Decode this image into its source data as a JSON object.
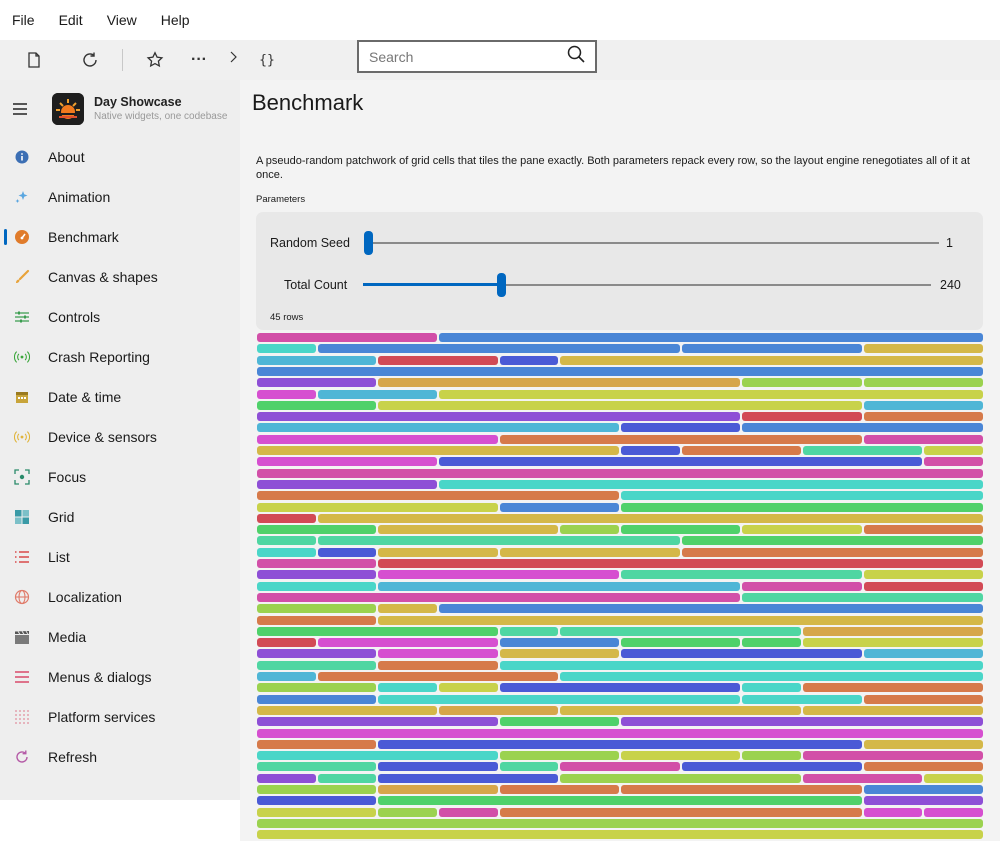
{
  "menu": [
    "File",
    "Edit",
    "View",
    "Help"
  ],
  "toolbar": {
    "icons": [
      "file-icon",
      "refresh-icon",
      "star-icon",
      "more-icon",
      "chevron-right-icon",
      "braces-icon"
    ],
    "search_placeholder": "Search"
  },
  "app": {
    "name": "Day Showcase",
    "tagline": "Native widgets, one codebase"
  },
  "nav": [
    {
      "label": "About",
      "icon": "info-icon",
      "color": "#3c6fb4"
    },
    {
      "label": "Animation",
      "icon": "sparkle-icon",
      "color": "#5aa6e0"
    },
    {
      "label": "Benchmark",
      "icon": "gauge-icon",
      "color": "#e07b2a",
      "selected": true
    },
    {
      "label": "Canvas & shapes",
      "icon": "brush-icon",
      "color": "#e8a33a"
    },
    {
      "label": "Controls",
      "icon": "sliders-icon",
      "color": "#3a9d4f"
    },
    {
      "label": "Crash Reporting",
      "icon": "broadcast-icon",
      "color": "#3aa63a"
    },
    {
      "label": "Date & time",
      "icon": "calendar-icon",
      "color": "#c8a43a"
    },
    {
      "label": "Device & sensors",
      "icon": "sensor-icon",
      "color": "#e0b43a"
    },
    {
      "label": "Focus",
      "icon": "focus-icon",
      "color": "#2a8a6a"
    },
    {
      "label": "Grid",
      "icon": "grid-icon",
      "color": "#3a9aa6"
    },
    {
      "label": "List",
      "icon": "list-icon",
      "color": "#d84a4a"
    },
    {
      "label": "Localization",
      "icon": "globe-icon",
      "color": "#e07b6a"
    },
    {
      "label": "Media",
      "icon": "clapper-icon",
      "color": "#7a7a7a"
    },
    {
      "label": "Menus & dialogs",
      "icon": "menu-icon",
      "color": "#d84a6a"
    },
    {
      "label": "Platform services",
      "icon": "dots-grid-icon",
      "color": "#e08a9a"
    },
    {
      "label": "Refresh",
      "icon": "refresh-icon",
      "color": "#b45aa6"
    }
  ],
  "page": {
    "title": "Benchmark",
    "description": "A pseudo-random patchwork of grid cells that tiles the pane exactly. Both parameters repack every row, so the layout engine renegotiates all of it at once.",
    "parameters_label": "Parameters",
    "random_seed": {
      "label": "Random Seed",
      "value": "1",
      "min": 1,
      "max": 100,
      "current": 1
    },
    "total_count": {
      "label": "Total Count",
      "value": "240",
      "min": 1,
      "max": 1000,
      "current": 240
    },
    "rows_label": "45 rows"
  },
  "palette": [
    "#d24a55",
    "#4fd16a",
    "#8e4fd6",
    "#d4b848",
    "#4fb6d6",
    "#d24fa8",
    "#9bd24f",
    "#4a5ad6",
    "#d67a4a",
    "#4fd6a2",
    "#c8d24a",
    "#4a86d6",
    "#d64fd0",
    "#4ad6c8",
    "#d6a64a"
  ]
}
